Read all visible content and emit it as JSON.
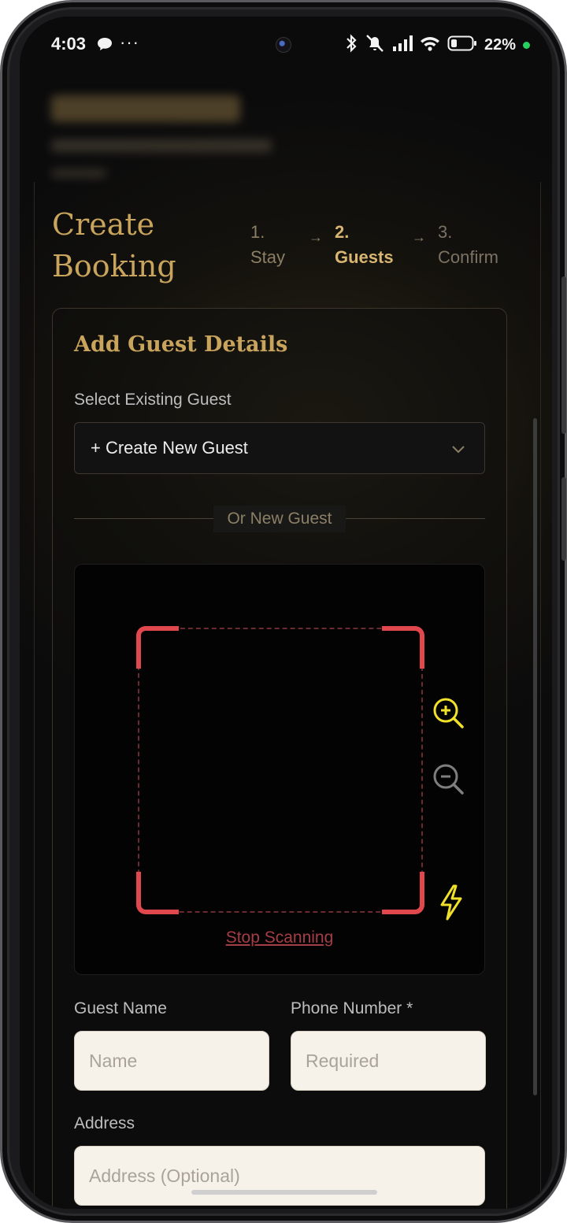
{
  "status_bar": {
    "time": "4:03",
    "more": "···",
    "battery": "22%"
  },
  "modal": {
    "title_line1": "Create",
    "title_line2": "Booking",
    "steps": [
      {
        "num": "1.",
        "label": "Stay"
      },
      {
        "num": "2.",
        "label": "Guests"
      },
      {
        "num": "3.",
        "label": "Confirm"
      }
    ],
    "step_arrow": "→"
  },
  "card": {
    "title": "Add Guest Details",
    "select_label": "Select Existing Guest",
    "select_value": "+ Create New Guest",
    "divider_text": "Or New Guest",
    "stop_scanning": "Stop Scanning",
    "guest_name_label": "Guest Name",
    "guest_name_placeholder": "Name",
    "phone_label": "Phone Number *",
    "phone_placeholder": "Required",
    "address_label": "Address",
    "address_placeholder": "Address (Optional)"
  },
  "colors": {
    "accent_gold": "#c9a45d",
    "scanner_red": "#e0484d",
    "icon_yellow": "#f2e12a"
  },
  "icons": [
    "chat-bubble-icon",
    "bluetooth-icon",
    "bell-muted-icon",
    "signal-icon",
    "wifi-icon",
    "battery-icon",
    "chevron-down-icon",
    "zoom-in-icon",
    "zoom-out-icon",
    "flash-icon"
  ]
}
